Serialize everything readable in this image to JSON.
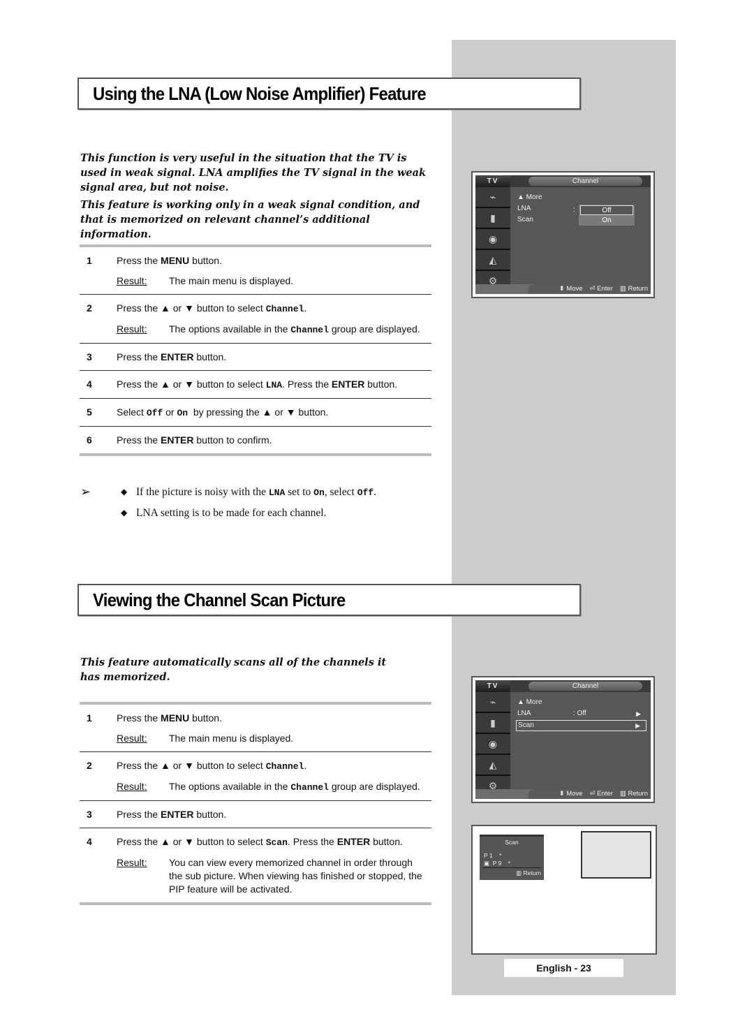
{
  "section1": {
    "title": "Using the LNA (Low Noise Amplifier) Feature",
    "intro": [
      "This function is very useful in the situation that the TV is used in weak signal. LNA amplifies the TV signal in the weak signal area, but not noise.",
      "This feature is working only in a weak signal condition, and that is memorized on relevant channel’s additional information."
    ],
    "steps": [
      {
        "num": "1",
        "parts": [
          "Press the ",
          "MENU",
          " button."
        ],
        "result_label": "Result",
        "result": "The main menu is displayed."
      },
      {
        "num": "2",
        "parts": [
          "Press the ▲ or ▼ button to select ",
          "Channel",
          "."
        ],
        "result_label": "Result",
        "result_parts": [
          "The options available in the ",
          "Channel",
          " group are displayed."
        ]
      },
      {
        "num": "3",
        "parts": [
          "Press the ",
          "ENTER",
          " button."
        ]
      },
      {
        "num": "4",
        "parts": [
          "Press the ▲ or ▼ button to select ",
          "LNA",
          ". Press the ",
          "ENTER",
          " button."
        ]
      },
      {
        "num": "5",
        "parts": [
          "Select ",
          "Off",
          " or ",
          "On",
          "  by pressing the ▲ or ▼ button."
        ]
      },
      {
        "num": "6",
        "parts": [
          "Press the ",
          "ENTER",
          " button to confirm."
        ]
      }
    ],
    "notes_arrow": "➢",
    "notes": [
      {
        "parts": [
          "If the picture is noisy with the ",
          "LNA",
          " set to ",
          "On",
          ", select ",
          "Off",
          "."
        ]
      },
      {
        "parts": [
          "LNA setting is to be made for each channel."
        ]
      }
    ],
    "osd": {
      "tv_label": "TV",
      "header": "Channel",
      "menu": [
        {
          "label": "▲ More",
          "value": "",
          "arrow": ""
        },
        {
          "label": "LNA",
          "value": "",
          "arrow": ""
        },
        {
          "label": "Scan",
          "value": "",
          "arrow": ""
        }
      ],
      "colon": ":",
      "dropdown": [
        "Off",
        "On"
      ],
      "dropdown_selected": "Off",
      "footer": {
        "move": "⬍ Move",
        "enter": "⏎ Enter",
        "return": "▥ Return"
      }
    }
  },
  "section2": {
    "title": "Viewing the Channel Scan Picture",
    "intro": [
      "This feature automatically scans all of the channels it has memorized."
    ],
    "steps": [
      {
        "num": "1",
        "parts": [
          "Press the ",
          "MENU",
          " button."
        ],
        "result_label": "Result",
        "result": "The main menu is displayed."
      },
      {
        "num": "2",
        "parts": [
          "Press the ▲ or ▼ button to select ",
          "Channel",
          "."
        ],
        "result_label": "Result",
        "result_parts": [
          "The options available in the ",
          "Channel",
          " group are displayed."
        ]
      },
      {
        "num": "3",
        "parts": [
          "Press the ",
          "ENTER",
          " button."
        ]
      },
      {
        "num": "4",
        "parts": [
          "Press the ▲ or ▼ button to select ",
          "Scan",
          ". Press the ",
          "ENTER",
          " button."
        ],
        "result_label": "Result",
        "result": "You can view every memorized channel in order through the sub picture. When viewing has finished or stopped, the PIP feature will be activated."
      }
    ],
    "osd": {
      "tv_label": "TV",
      "header": "Channel",
      "menu": [
        {
          "label": "▲ More",
          "value": "",
          "arrow": ""
        },
        {
          "label": "LNA",
          "value": ": Off",
          "arrow": "▶"
        },
        {
          "label": "Scan",
          "value": "",
          "arrow": "▶"
        }
      ],
      "selected": "Scan",
      "footer": {
        "move": "⬍ Move",
        "enter": "⏎ Enter",
        "return": "▥ Return"
      }
    },
    "pip": {
      "title": "Scan",
      "row1": "P 1    *",
      "row2": "▣  P 9    *",
      "return": "▥ Return"
    }
  },
  "footer": {
    "page_label": "English - 23"
  }
}
